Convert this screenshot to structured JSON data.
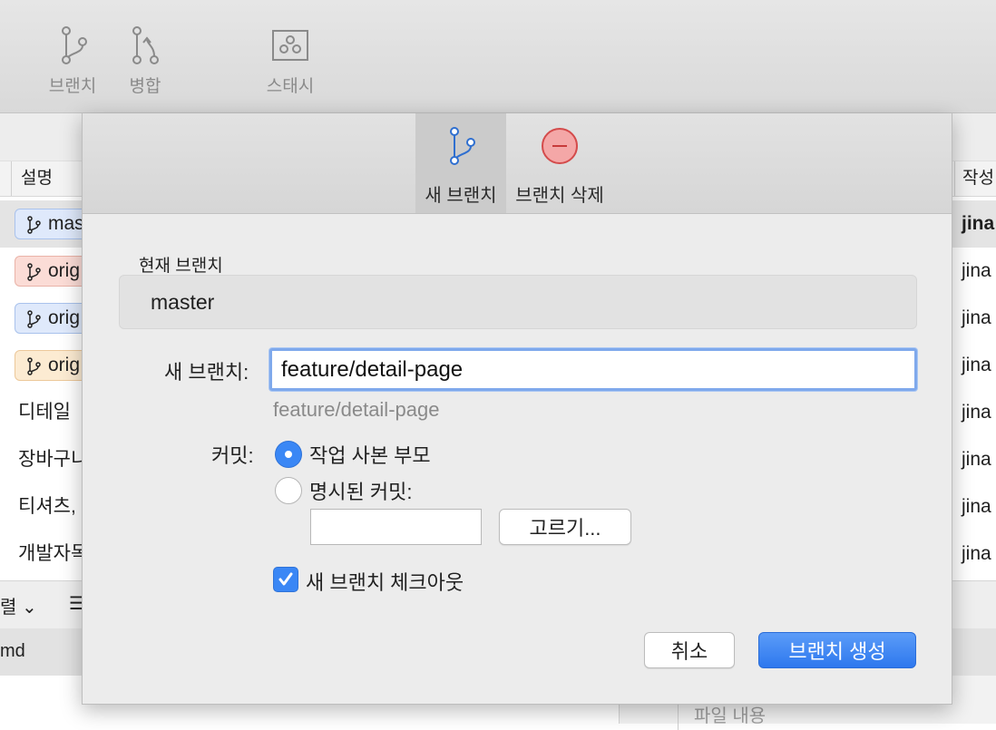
{
  "toolbar": {
    "branch_label": "브랜치",
    "merge_label": "병합",
    "stash_label": "스태시",
    "title_fragment": "(  )"
  },
  "table": {
    "col_description": "설명",
    "col_author": "작성",
    "rows": [
      {
        "badge": "mas",
        "badge_color": "blue",
        "author": "jina"
      },
      {
        "badge": "orig",
        "badge_color": "red",
        "author": "jina"
      },
      {
        "badge": "orig",
        "badge_color": "blue",
        "author": "jina"
      },
      {
        "badge": "orig",
        "badge_color": "orange",
        "author": "jina"
      },
      {
        "text": "디테일",
        "author": "jina"
      },
      {
        "text": "장바구니",
        "author": "jina"
      },
      {
        "text": "티셔츠,",
        "author": "jina"
      },
      {
        "text": "개발자목",
        "author": "jina"
      }
    ]
  },
  "lower": {
    "sort_label": "렬 ⌄",
    "menu_icon": "list-icon",
    "file_name": "md",
    "file_content_label": "파일 내용"
  },
  "dialog": {
    "tab_new_branch": "새 브랜치",
    "tab_delete_branch": "브랜치 삭제",
    "current_branch_label": "현재 브랜치",
    "current_branch_value": "master",
    "new_branch_label": "새 브랜치:",
    "new_branch_value": "feature/detail-page",
    "new_branch_preview": "feature/detail-page",
    "commit_label": "커밋:",
    "radio_working_copy": "작업 사본 부모",
    "radio_specified": "명시된 커밋:",
    "choose_button": "고르기...",
    "checkout_label": "새 브랜치 체크아웃",
    "cancel_button": "취소",
    "create_button": "브랜치 생성",
    "accent_color": "#3a87f5"
  }
}
